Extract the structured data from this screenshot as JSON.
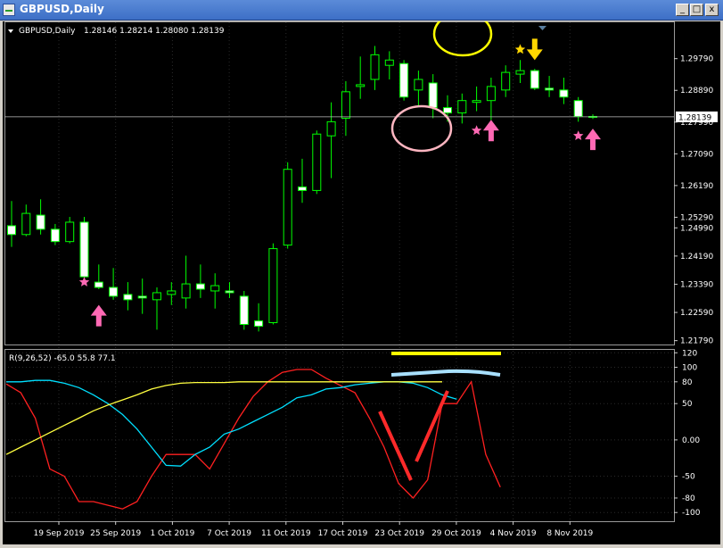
{
  "window": {
    "title": "GBPUSD,Daily",
    "minimize_label": "_",
    "maximize_label": "□",
    "close_label": "x"
  },
  "chart_data": [
    {
      "type": "candlestick",
      "symbol_label": "GBPUSD,Daily",
      "ohlc_label": "1.28146 1.28214 1.28080 1.28139",
      "last_price_label": "1.28139",
      "last_price": 1.28139,
      "ylim": [
        1.2168,
        1.3039
      ],
      "y_ticks": [
        "1.29790",
        "1.28890",
        "1.27990",
        "1.27090",
        "1.26190",
        "1.25290",
        "1.24990",
        "1.24190",
        "1.23390",
        "1.22590",
        "1.21790"
      ],
      "y_tick_values": [
        1.2979,
        1.2889,
        1.2799,
        1.2709,
        1.2619,
        1.2529,
        1.2499,
        1.2419,
        1.2339,
        1.2259,
        1.2179
      ],
      "x_ticks": [
        "19 Sep 2019",
        "25 Sep 2019",
        "1 Oct 2019",
        "7 Oct 2019",
        "11 Oct 2019",
        "17 Oct 2019",
        "23 Oct 2019",
        "29 Oct 2019",
        "4 Nov 2019",
        "8 Nov 2019"
      ],
      "bull_color": "#00ff00",
      "bear_color": "#ffffff",
      "candles": [
        {
          "o": 1.2505,
          "h": 1.2575,
          "l": 1.2445,
          "c": 1.248
        },
        {
          "o": 1.248,
          "h": 1.2565,
          "l": 1.2475,
          "c": 1.254
        },
        {
          "o": 1.2535,
          "h": 1.258,
          "l": 1.248,
          "c": 1.2495
        },
        {
          "o": 1.2495,
          "h": 1.251,
          "l": 1.245,
          "c": 1.246
        },
        {
          "o": 1.246,
          "h": 1.253,
          "l": 1.2455,
          "c": 1.2515
        },
        {
          "o": 1.2515,
          "h": 1.253,
          "l": 1.2345,
          "c": 1.236
        },
        {
          "o": 1.2345,
          "h": 1.2395,
          "l": 1.2325,
          "c": 1.233
        },
        {
          "o": 1.233,
          "h": 1.2385,
          "l": 1.2295,
          "c": 1.2305
        },
        {
          "o": 1.231,
          "h": 1.2345,
          "l": 1.2265,
          "c": 1.2295
        },
        {
          "o": 1.2305,
          "h": 1.2355,
          "l": 1.2255,
          "c": 1.23
        },
        {
          "o": 1.2295,
          "h": 1.233,
          "l": 1.221,
          "c": 1.2315
        },
        {
          "o": 1.231,
          "h": 1.2345,
          "l": 1.228,
          "c": 1.232
        },
        {
          "o": 1.23,
          "h": 1.242,
          "l": 1.227,
          "c": 1.234
        },
        {
          "o": 1.234,
          "h": 1.2395,
          "l": 1.23,
          "c": 1.2325
        },
        {
          "o": 1.232,
          "h": 1.237,
          "l": 1.227,
          "c": 1.2335
        },
        {
          "o": 1.232,
          "h": 1.2345,
          "l": 1.23,
          "c": 1.2315
        },
        {
          "o": 1.2305,
          "h": 1.232,
          "l": 1.221,
          "c": 1.2225
        },
        {
          "o": 1.2235,
          "h": 1.2285,
          "l": 1.2205,
          "c": 1.222
        },
        {
          "o": 1.223,
          "h": 1.2455,
          "l": 1.2225,
          "c": 1.244
        },
        {
          "o": 1.245,
          "h": 1.2685,
          "l": 1.244,
          "c": 1.2665
        },
        {
          "o": 1.2615,
          "h": 1.2695,
          "l": 1.257,
          "c": 1.2605
        },
        {
          "o": 1.2605,
          "h": 1.2775,
          "l": 1.2595,
          "c": 1.2765
        },
        {
          "o": 1.276,
          "h": 1.2855,
          "l": 1.264,
          "c": 1.28
        },
        {
          "o": 1.281,
          "h": 1.2915,
          "l": 1.276,
          "c": 1.2885
        },
        {
          "o": 1.29,
          "h": 1.2985,
          "l": 1.2865,
          "c": 1.2905
        },
        {
          "o": 1.292,
          "h": 1.3015,
          "l": 1.289,
          "c": 1.299
        },
        {
          "o": 1.296,
          "h": 1.3,
          "l": 1.292,
          "c": 1.2975
        },
        {
          "o": 1.2965,
          "h": 1.2975,
          "l": 1.286,
          "c": 1.287
        },
        {
          "o": 1.289,
          "h": 1.2945,
          "l": 1.2845,
          "c": 1.292
        },
        {
          "o": 1.291,
          "h": 1.2935,
          "l": 1.281,
          "c": 1.284
        },
        {
          "o": 1.284,
          "h": 1.2875,
          "l": 1.28,
          "c": 1.2825
        },
        {
          "o": 1.2825,
          "h": 1.288,
          "l": 1.2795,
          "c": 1.286
        },
        {
          "o": 1.2855,
          "h": 1.29,
          "l": 1.283,
          "c": 1.286
        },
        {
          "o": 1.286,
          "h": 1.2925,
          "l": 1.2805,
          "c": 1.29
        },
        {
          "o": 1.289,
          "h": 1.296,
          "l": 1.287,
          "c": 1.294
        },
        {
          "o": 1.2935,
          "h": 1.2975,
          "l": 1.291,
          "c": 1.2945
        },
        {
          "o": 1.2945,
          "h": 1.295,
          "l": 1.289,
          "c": 1.2895
        },
        {
          "o": 1.2895,
          "h": 1.293,
          "l": 1.287,
          "c": 1.289
        },
        {
          "o": 1.289,
          "h": 1.2925,
          "l": 1.285,
          "c": 1.287
        },
        {
          "o": 1.286,
          "h": 1.287,
          "l": 1.28,
          "c": 1.2815
        },
        {
          "o": 1.2815,
          "h": 1.2821,
          "l": 1.2808,
          "c": 1.2814
        }
      ],
      "markers": [
        {
          "kind": "star",
          "index": 5,
          "price": 1.2345,
          "color": "#ff69b4"
        },
        {
          "kind": "up-arrow",
          "index": 6,
          "price": 1.225,
          "color": "#ff69b4"
        },
        {
          "kind": "star",
          "index": 32,
          "price": 1.2775,
          "color": "#ff69b4"
        },
        {
          "kind": "up-arrow",
          "index": 33,
          "price": 1.2775,
          "color": "#ff69b4"
        },
        {
          "kind": "star",
          "index": 39,
          "price": 1.276,
          "color": "#ff69b4"
        },
        {
          "kind": "up-arrow",
          "index": 40,
          "price": 1.275,
          "color": "#ff69b4"
        },
        {
          "kind": "star",
          "index": 35,
          "price": 1.3005,
          "color": "#ffd700"
        },
        {
          "kind": "down-arrow",
          "index": 36,
          "price": 1.3005,
          "color": "#ffd700"
        }
      ]
    },
    {
      "type": "line",
      "indicator_label": "R(9,26,52) -65.0 55.8 77.1",
      "ylim": [
        -112,
        124
      ],
      "y_ticks": [
        "120",
        "100",
        "80",
        "50",
        "0.00",
        "-50",
        "-80",
        "-100"
      ],
      "y_tick_values": [
        120,
        100,
        80,
        50,
        0,
        -50,
        -80,
        -100
      ],
      "series": [
        {
          "color": "#ff2020",
          "values": [
            77,
            65,
            30,
            -40,
            -50,
            -85,
            -85,
            -90,
            -95,
            -85,
            -50,
            -20,
            -20,
            -20,
            -40,
            -5,
            30,
            60,
            80,
            93,
            97,
            97,
            85,
            75,
            65,
            30,
            -10,
            -60,
            -80,
            -55,
            50,
            50,
            80,
            -20,
            -65
          ]
        },
        {
          "color": "#00e0ff",
          "values": [
            80,
            80,
            82,
            82,
            78,
            72,
            62,
            50,
            35,
            15,
            -10,
            -35,
            -36,
            -20,
            -10,
            8,
            15,
            25,
            35,
            45,
            58,
            62,
            70,
            72,
            76,
            78,
            80,
            80,
            78,
            72,
            62,
            56
          ]
        },
        {
          "color": "#ffff40",
          "values": [
            -20,
            -10,
            0,
            10,
            20,
            30,
            40,
            48,
            55,
            62,
            70,
            75,
            78,
            79,
            79,
            79,
            80,
            80,
            80,
            80,
            80,
            80,
            80,
            80,
            80,
            80,
            80,
            80,
            80,
            80,
            80
          ]
        }
      ]
    }
  ]
}
